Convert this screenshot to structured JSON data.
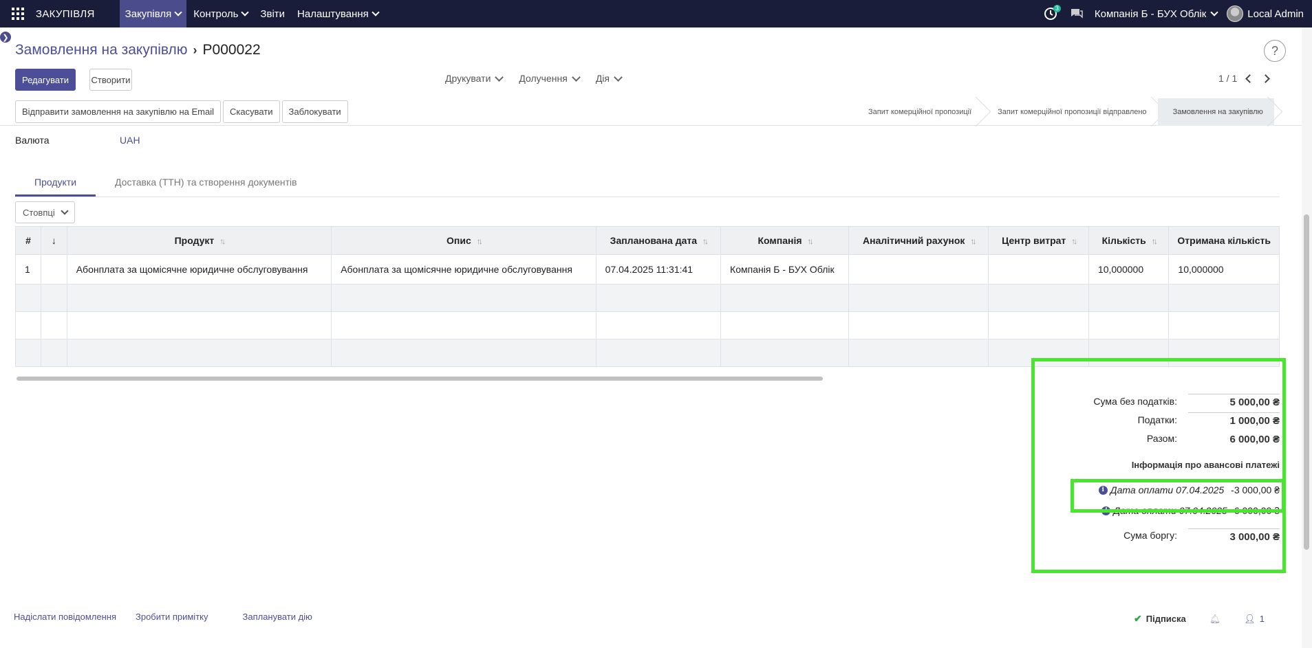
{
  "navbar": {
    "brand": "ЗАКУПІВЛЯ",
    "menu": [
      {
        "label": "Закупівля",
        "active": true,
        "dropdown": true
      },
      {
        "label": "Контроль",
        "dropdown": true
      },
      {
        "label": "Звіти",
        "dropdown": false
      },
      {
        "label": "Налаштування",
        "dropdown": true
      }
    ],
    "activity_count": "3",
    "company": "Компанія Б - БУХ Облік",
    "user": "Local Admin"
  },
  "breadcrumb": {
    "parent": "Замовлення на закупівлю",
    "current": "P000022"
  },
  "toolbar": {
    "edit_label": "Редагувати",
    "create_label": "Створити",
    "print_label": "Друкувати",
    "attach_label": "Долучення",
    "action_label": "Дія",
    "pager": "1 / 1",
    "help": "?"
  },
  "statusbar": {
    "buttons": [
      "Відправити замовлення на закупівлю на Email",
      "Скасувати",
      "Заблокувати"
    ],
    "stages": [
      "Запит комерційної пропозиції",
      "Запит комерційної пропозиції відправлено",
      "Замовлення на закупівлю"
    ],
    "active_stage": 2
  },
  "form": {
    "currency_label": "Валюта",
    "currency_value": "UAH"
  },
  "tabs": [
    "Продукти",
    "Доставка (ТТН) та створення документів"
  ],
  "columns_label": "Стовпці",
  "table": {
    "headers": [
      "#",
      "↓",
      "Продукт",
      "Опис",
      "Запланована дата",
      "Компанія",
      "Аналітичний рахунок",
      "Центр витрат",
      "Кількість",
      "Отримана кількість"
    ],
    "rows": [
      [
        "1",
        "",
        "Абонплата за щомісячне юридичне обслуговування",
        "Абонплата за щомісячне юридичне обслуговування",
        "07.04.2025 11:31:41",
        "Компанія Б - БУХ Облік",
        "",
        "",
        "10,000000",
        "10,000000"
      ]
    ]
  },
  "totals": {
    "untaxed_label": "Сума без податків:",
    "untaxed_value": "5 000,00 ₴",
    "tax_label": "Податки:",
    "tax_value": "1 000,00 ₴",
    "total_label": "Разом:",
    "total_value": "6 000,00 ₴",
    "advance_title": "Інформація про авансові платежі",
    "payments": [
      {
        "date": "Дата оплати 07.04.2025",
        "amount": "-3 000,00 ₴"
      },
      {
        "date": "Дата оплати 07.04.2025",
        "amount": "6 000,00 ₴"
      }
    ],
    "debt_label": "Сума боргу:",
    "debt_value": "3 000,00 ₴"
  },
  "chatter": {
    "send_message": "Надіслати повідомлення",
    "log_note": "Зробити примітку",
    "schedule_activity": "Запланувати дію",
    "subscribe": "Підписка",
    "followers": "1"
  },
  "colors": {
    "navbar_bg": "#1a1d3a",
    "accent": "#4c4e97",
    "highlight": "#4ae62f"
  }
}
